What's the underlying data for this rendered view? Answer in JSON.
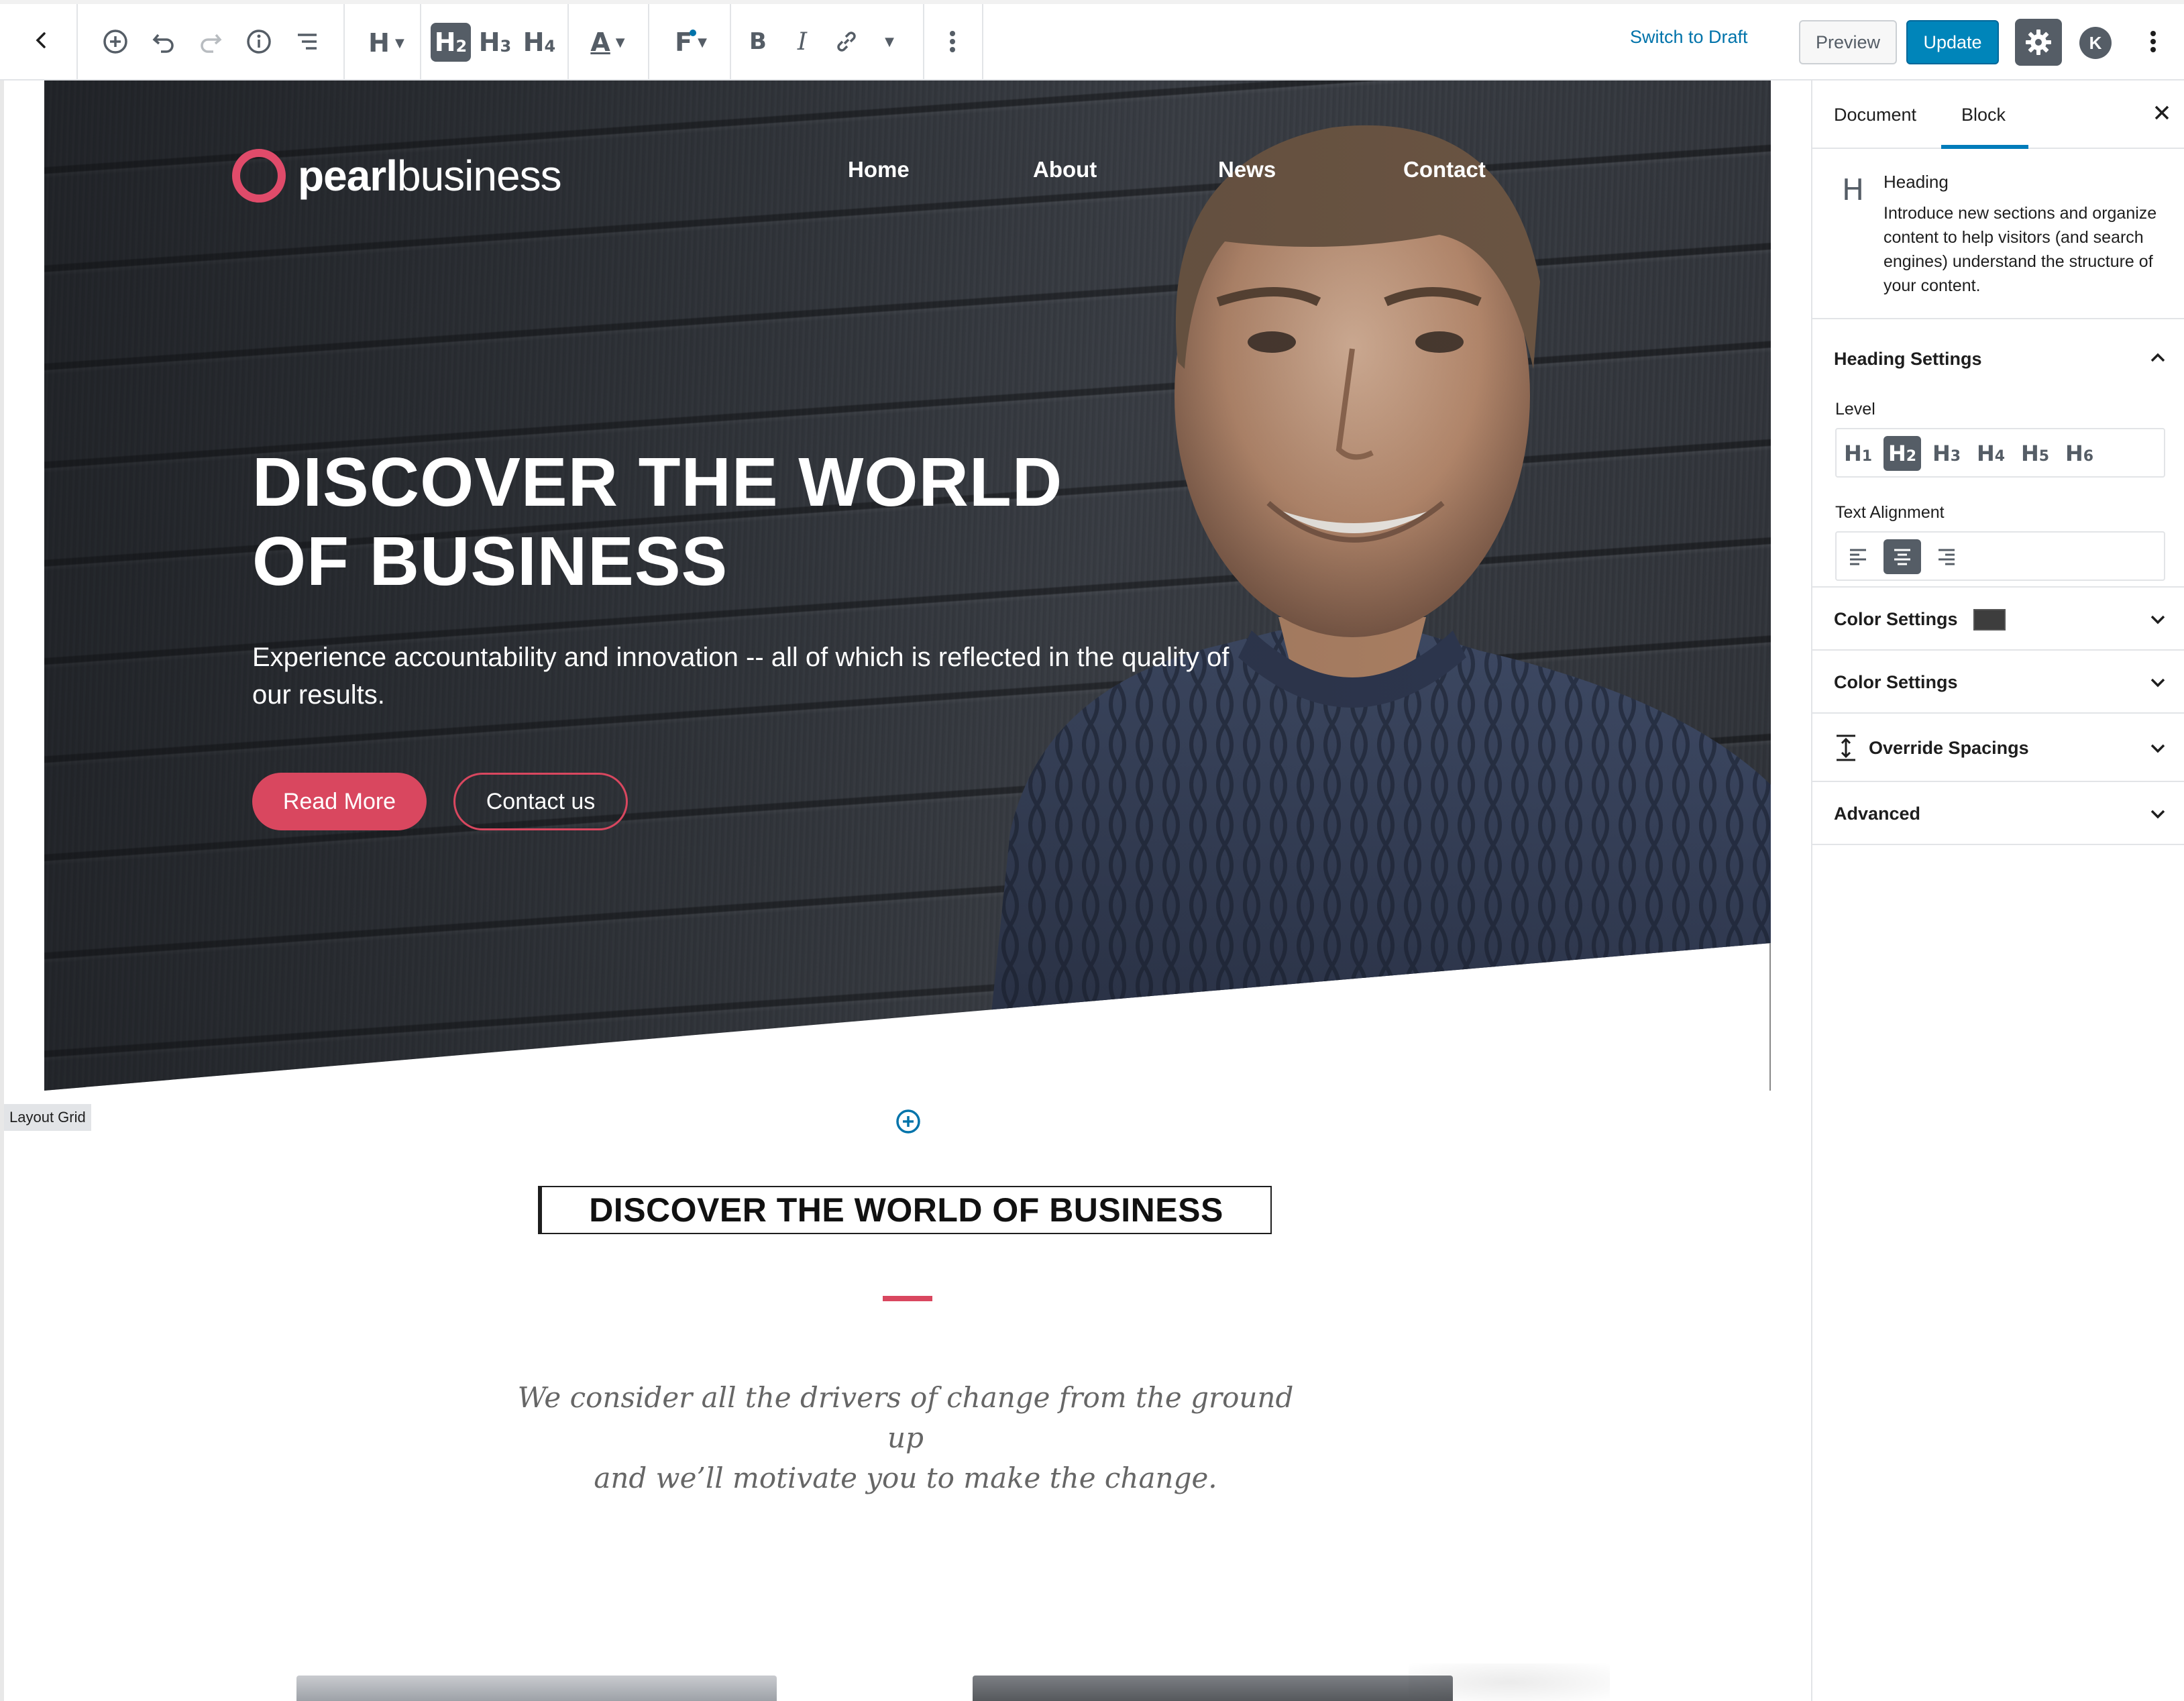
{
  "toolbar": {
    "heading_tool": "H",
    "h2": "H",
    "h2_level": "2",
    "h3": "H",
    "h3_level": "3",
    "h4": "H",
    "h4_level": "4",
    "text_color": "A",
    "font": "F",
    "bold": "B",
    "italic": "I",
    "switch_to_draft": "Switch to Draft",
    "preview": "Preview",
    "update": "Update",
    "avatar_initial": "K"
  },
  "hero": {
    "logo_bold": "pearl",
    "logo_light": "business",
    "nav": [
      "Home",
      "About",
      "News",
      "Contact"
    ],
    "title_line1": "DISCOVER THE WORLD",
    "title_line2": "OF BUSINESS",
    "subtitle": "Experience accountability and innovation -- all of which is reflected in the quality of our results.",
    "read_more": "Read More",
    "contact_us": "Contact us"
  },
  "editor": {
    "block_label": "Layout Grid",
    "section_heading": "DISCOVER THE WORLD OF BUSINESS",
    "quote_line1": "We consider all the drivers of change from the ground up",
    "quote_line2": "and we’ll motivate you to make the change."
  },
  "sidebar": {
    "tabs": [
      "Document",
      "Block"
    ],
    "active_tab": "Block",
    "block": {
      "icon": "H",
      "title": "Heading",
      "description": "Introduce new sections and organize content to help visitors (and search engines) understand the structure of your content."
    },
    "heading_settings": {
      "title": "Heading Settings",
      "level_label": "Level",
      "levels": [
        {
          "letter": "H",
          "num": "1"
        },
        {
          "letter": "H",
          "num": "2"
        },
        {
          "letter": "H",
          "num": "3"
        },
        {
          "letter": "H",
          "num": "4"
        },
        {
          "letter": "H",
          "num": "5"
        },
        {
          "letter": "H",
          "num": "6"
        }
      ],
      "active_level": "2",
      "alignment_label": "Text Alignment",
      "active_alignment": "center"
    },
    "panels": [
      "Color Settings",
      "Color Settings",
      "Override Spacings",
      "Advanced"
    ],
    "color_swatch": "#3d3d3d"
  },
  "colors": {
    "accent": "#d9475f",
    "primary_button": "#0085ba",
    "link": "#0073aa",
    "toolbar_icon": "#555d66"
  }
}
